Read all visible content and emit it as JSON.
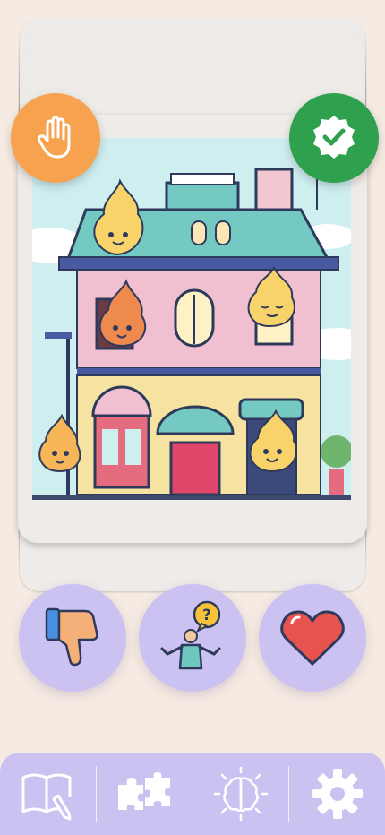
{
  "card": {
    "illustration": "cartoon-house-with-flame-mascots"
  },
  "badges": {
    "left_icon": "hand-stop-icon",
    "right_icon": "verified-check-icon",
    "left_color": "#f7a24e",
    "right_color": "#2fa14e"
  },
  "actions": [
    {
      "icon": "thumbs-down-icon"
    },
    {
      "icon": "question-shrug-icon"
    },
    {
      "icon": "heart-icon"
    }
  ],
  "nav": [
    {
      "icon": "book-pencil-icon"
    },
    {
      "icon": "puzzle-pieces-icon"
    },
    {
      "icon": "brain-idea-icon"
    },
    {
      "icon": "gear-icon"
    }
  ],
  "colors": {
    "background": "#f6ebe2",
    "accent": "#cbc2f1",
    "heart": "#e8524f"
  }
}
